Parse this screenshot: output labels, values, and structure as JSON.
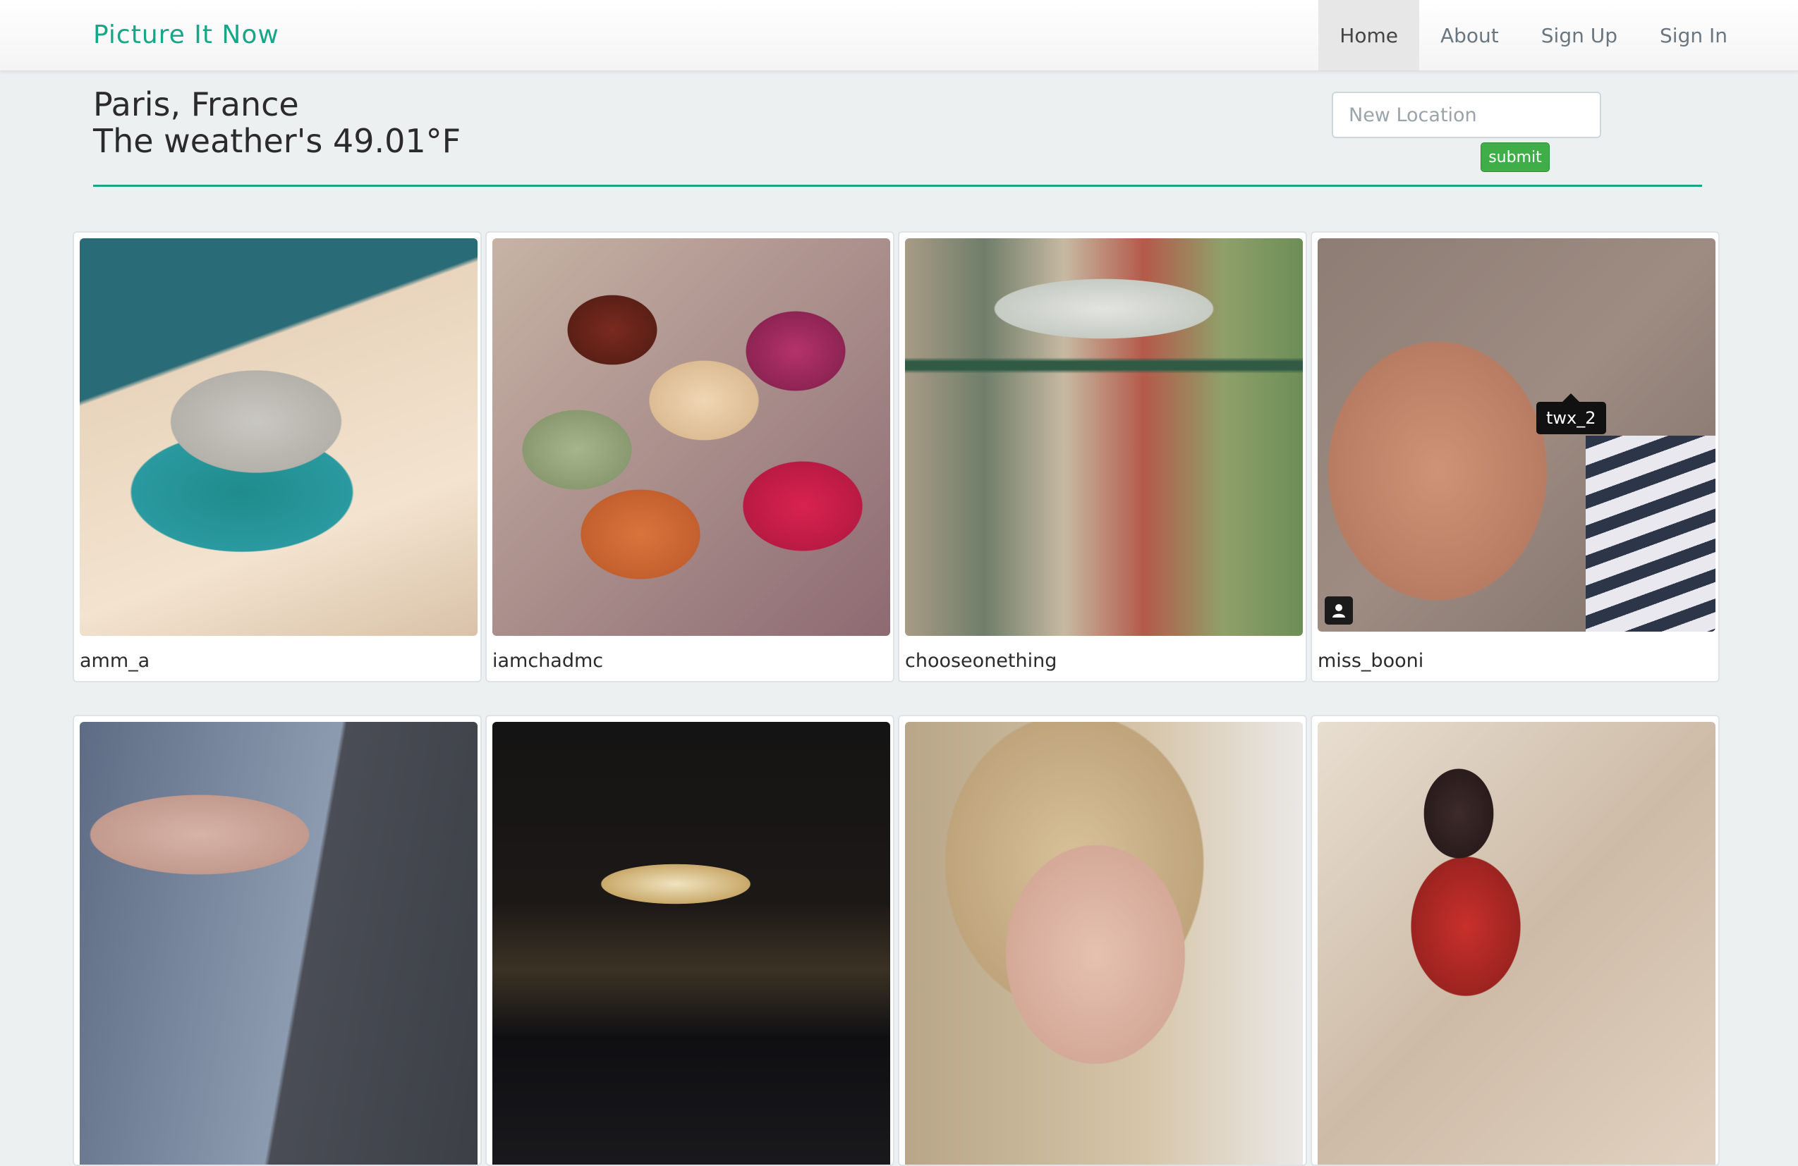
{
  "brand": "Picture It Now",
  "nav": [
    {
      "label": "Home",
      "active": true
    },
    {
      "label": "About",
      "active": false
    },
    {
      "label": "Sign Up",
      "active": false
    },
    {
      "label": "Sign In",
      "active": false
    }
  ],
  "location": {
    "city": "Paris, France",
    "weather": "The weather's 49.01°F"
  },
  "search": {
    "placeholder": "New Location",
    "submit_label": "submit"
  },
  "photos": [
    {
      "username": "amm_a"
    },
    {
      "username": "iamchadmc"
    },
    {
      "username": "chooseonething"
    },
    {
      "username": "miss_booni",
      "tooltip": "twx_2",
      "icon": "user-icon"
    },
    {
      "username": ""
    },
    {
      "username": ""
    },
    {
      "username": ""
    },
    {
      "username": ""
    }
  ],
  "colors": {
    "brand": "#18a689",
    "background": "#ecf0f1",
    "submit": "#3fae49"
  }
}
